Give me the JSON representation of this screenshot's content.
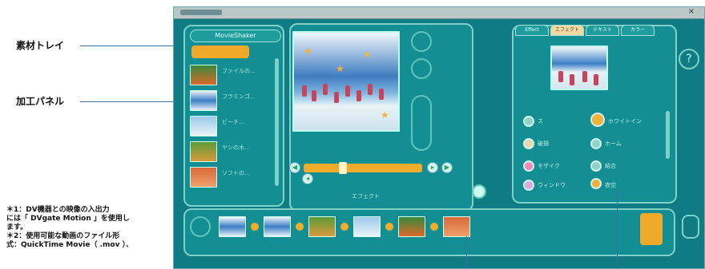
{
  "callouts": {
    "material_tray": "素材トレイ",
    "edit_panel": "加工パネル"
  },
  "notes": [
    "＊1：DV機器との映像の入出力",
    "には「 DVgate  Motion 」を使用し",
    "ます。",
    "＊2：使用可能な動画のファイル形",
    "式：QuickTime Movie（ .mov ）、"
  ],
  "app": {
    "tray_tab": "MovieShaker",
    "tray_items": [
      {
        "text": "ファイルの…"
      },
      {
        "text": "フラミンゴ…"
      },
      {
        "text": "ビーチ…"
      },
      {
        "text": "ヤシの木…"
      },
      {
        "text": "ソフトの…"
      }
    ],
    "edit_tabs": [
      "Effect",
      "エフェクト",
      "テキスト",
      "カラー"
    ],
    "effects": [
      {
        "label": "ス",
        "color": "#8fd4c8"
      },
      {
        "label": "ホワイトイン",
        "color": "#f2b23a"
      },
      {
        "label": "破損",
        "color": "#e9d9a8"
      },
      {
        "label": "ホーム",
        "color": "#8fd4c8"
      },
      {
        "label": "モザイク",
        "color": "#f28ab4"
      },
      {
        "label": "結合",
        "color": "#8fd4c8"
      },
      {
        "label": "ウィンドウ",
        "color": "#d9a8e6"
      },
      {
        "label": "夜空",
        "color": "#f2b23a"
      }
    ],
    "timeline_label": "エフェクト",
    "colors": {
      "app_bg": "#0f7c84",
      "accent": "#f0a928",
      "panel_border": "#7fd0c8"
    }
  }
}
